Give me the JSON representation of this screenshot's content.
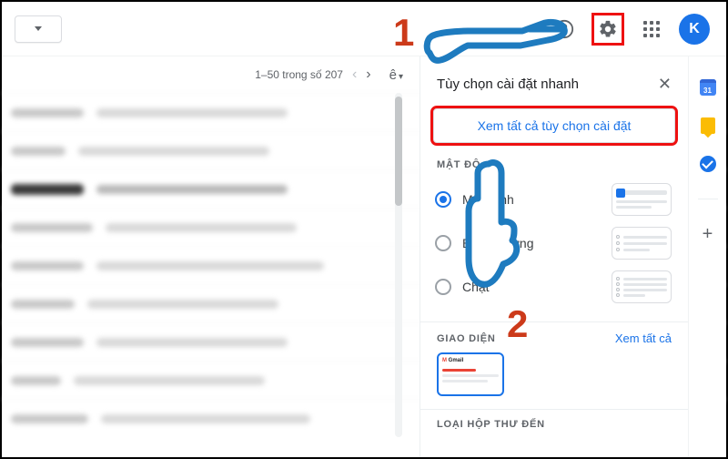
{
  "header": {
    "avatar_letter": "K"
  },
  "toolbar": {
    "page_count": "1–50 trong số 207",
    "lang_btn": "ê"
  },
  "panel": {
    "title": "Tùy chọn cài đặt nhanh",
    "see_all": "Xem tất cả tùy chọn cài đặt",
    "density_title": "MẬT ĐỘ",
    "density_options": [
      "Mặc định",
      "Bình thường",
      "Chật"
    ],
    "theme_title": "GIAO DIỆN",
    "see_all_link": "Xem tất cả",
    "inbox_title": "LOẠI HỘP THƯ ĐẾN"
  },
  "annotations": {
    "one": "1",
    "two": "2"
  },
  "rail": {
    "calendar_day": "31"
  }
}
